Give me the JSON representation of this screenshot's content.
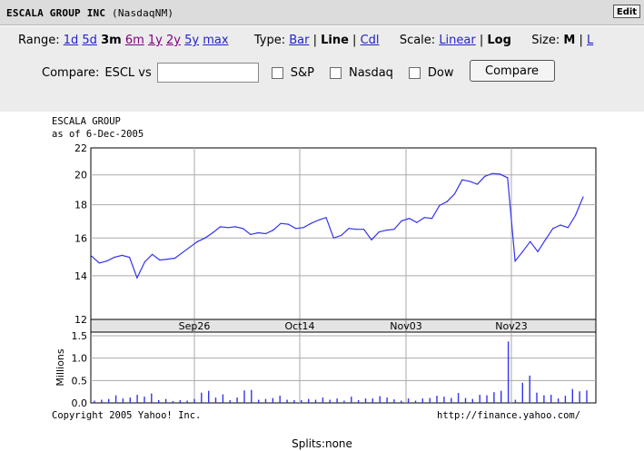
{
  "header": {
    "company": "ESCALA GROUP INC",
    "exchange": "(NasdaqNM)",
    "edit_label": "Edit"
  },
  "controls": {
    "range_label": "Range:",
    "range_options": [
      "1d",
      "5d",
      "3m",
      "6m",
      "1y",
      "2y",
      "5y",
      "max"
    ],
    "range_selected": "3m",
    "type_label": "Type:",
    "type_options": [
      "Bar",
      "Line",
      "Cdl"
    ],
    "type_selected": "Line",
    "scale_label": "Scale:",
    "scale_options": [
      "Linear",
      "Log"
    ],
    "scale_selected": "Log",
    "size_label": "Size:",
    "size_options": [
      "M",
      "L"
    ],
    "size_selected": "M",
    "compare_label": "Compare:",
    "compare_vs": "ESCL vs",
    "compare_value": "",
    "index_options": [
      "S&P",
      "Nasdaq",
      "Dow"
    ],
    "compare_button": "Compare"
  },
  "chart_header": {
    "name": "ESCALA GROUP",
    "asof": "as of 6-Dec-2005"
  },
  "footer": {
    "copyright": "Copyright 2005 Yahoo! Inc.",
    "url": "http://finance.yahoo.com/",
    "splits": "Splits:none"
  },
  "colors": {
    "line": "#3333ee",
    "grid": "#aaaaaa",
    "band": "#e4e4e4",
    "link": "#2222cc",
    "visited": "#800080"
  },
  "chart_data": [
    {
      "type": "line",
      "title": "ESCALA GROUP",
      "scale": "log",
      "ylim": [
        12,
        22
      ],
      "yticks": [
        12,
        14,
        16,
        18,
        20,
        22
      ],
      "xticks": [
        "Sep26",
        "Oct14",
        "Nov03",
        "Nov23"
      ],
      "grid": true,
      "values": [
        15.0,
        14.65,
        14.75,
        14.95,
        15.05,
        14.95,
        13.9,
        14.7,
        15.1,
        14.8,
        14.85,
        14.9,
        15.2,
        15.5,
        15.8,
        16.0,
        16.3,
        16.65,
        16.6,
        16.65,
        16.55,
        16.2,
        16.3,
        16.25,
        16.45,
        16.85,
        16.8,
        16.55,
        16.6,
        16.85,
        17.05,
        17.2,
        16.0,
        16.15,
        16.55,
        16.5,
        16.5,
        15.9,
        16.35,
        16.45,
        16.5,
        17.0,
        17.15,
        16.9,
        17.2,
        17.15,
        17.95,
        18.2,
        18.7,
        19.65,
        19.55,
        19.35,
        19.9,
        20.1,
        20.05,
        19.8,
        14.75,
        15.25,
        15.8,
        15.25,
        15.9,
        16.55,
        16.75,
        16.6,
        17.35,
        18.5
      ]
    },
    {
      "type": "bar",
      "title": "",
      "ylabel": "Millions",
      "ylim": [
        0,
        1.5
      ],
      "yticks": [
        0.0,
        0.5,
        1.0,
        1.5
      ],
      "grid": true,
      "values": [
        0.05,
        0.07,
        0.09,
        0.17,
        0.1,
        0.12,
        0.18,
        0.14,
        0.21,
        0.06,
        0.09,
        0.04,
        0.06,
        0.05,
        0.09,
        0.23,
        0.27,
        0.12,
        0.19,
        0.06,
        0.12,
        0.28,
        0.29,
        0.07,
        0.09,
        0.11,
        0.16,
        0.07,
        0.06,
        0.06,
        0.09,
        0.07,
        0.12,
        0.07,
        0.1,
        0.05,
        0.14,
        0.06,
        0.1,
        0.1,
        0.15,
        0.12,
        0.08,
        0.05,
        0.1,
        0.05,
        0.1,
        0.11,
        0.16,
        0.14,
        0.11,
        0.22,
        0.11,
        0.09,
        0.18,
        0.17,
        0.24,
        0.27,
        1.37,
        0.07,
        0.45,
        0.61,
        0.23,
        0.17,
        0.18,
        0.1,
        0.16,
        0.31,
        0.26,
        0.28
      ]
    }
  ]
}
